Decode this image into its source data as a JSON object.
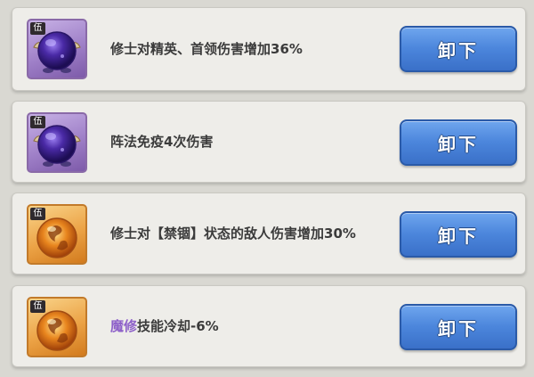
{
  "equipment_list": {
    "items": [
      {
        "grade": "伍",
        "icon": "purple-orb-icon",
        "description": "修士对精英、首领伤害增加36%",
        "highlight": "",
        "rest": "",
        "button_label": "卸下"
      },
      {
        "grade": "伍",
        "icon": "purple-orb-icon",
        "description": "阵法免疫4次伤害",
        "highlight": "",
        "rest": "",
        "button_label": "卸下"
      },
      {
        "grade": "伍",
        "icon": "flame-orb-icon",
        "description": "修士对【禁锢】状态的敌人伤害增加30%",
        "highlight": "",
        "rest": "",
        "button_label": "卸下"
      },
      {
        "grade": "伍",
        "icon": "flame-orb-icon",
        "description": "",
        "highlight": "魔修",
        "rest": "技能冷却-6%",
        "button_label": "卸下"
      }
    ]
  },
  "colors": {
    "highlight_text": "#8e61c9",
    "button_blue": "#4c86dc",
    "card_bg": "#eeede9"
  }
}
